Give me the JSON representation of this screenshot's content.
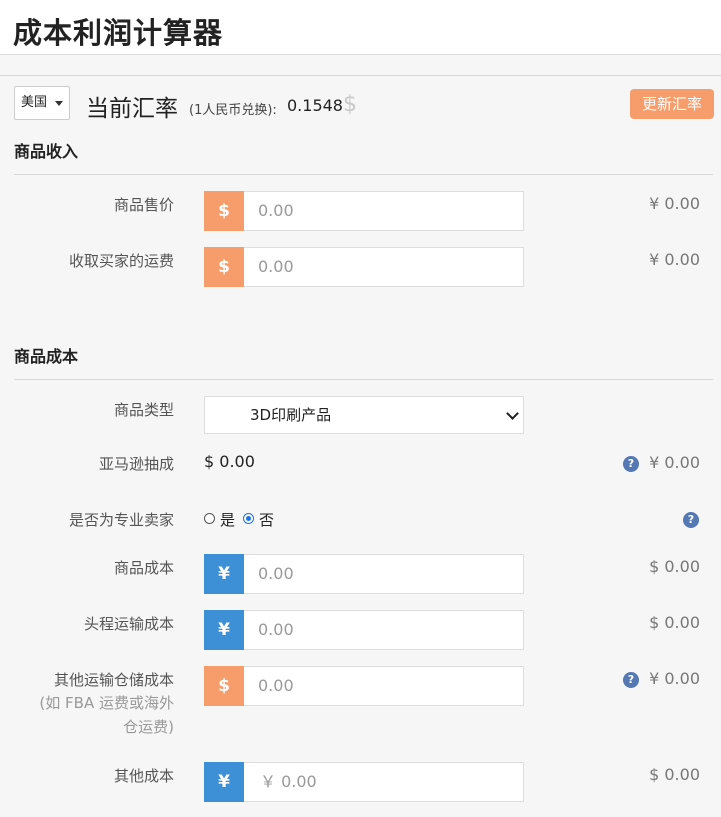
{
  "header": {
    "title": "成本利润计算器"
  },
  "exchange": {
    "country": "美国",
    "title": "当前汇率",
    "note": "(1人民币兑换):",
    "value": "0.1548",
    "currency_symbol": "$",
    "update_label": "更新汇率"
  },
  "income": {
    "title": "商品收入",
    "fields": [
      {
        "label": "商品售价",
        "addon": "$",
        "value": "0.00",
        "result": "¥ 0.00"
      },
      {
        "label": "收取买家的运费",
        "addon": "$",
        "value": "0.00",
        "result": "¥ 0.00"
      }
    ]
  },
  "cost": {
    "title": "商品成本",
    "type": {
      "label": "商品类型",
      "selected": "3D印刷产品"
    },
    "commission": {
      "label": "亚马逊抽成",
      "value": "$ 0.00",
      "result": "¥ 0.00"
    },
    "pro_seller": {
      "label": "是否为专业卖家",
      "options": [
        "是",
        "否"
      ],
      "selected": "否"
    },
    "fields": [
      {
        "label": "商品成本",
        "addon": "¥",
        "value": "0.00",
        "result": "$ 0.00"
      },
      {
        "label": "头程运输成本",
        "addon": "¥",
        "value": "0.00",
        "result": "$ 0.00"
      },
      {
        "label": "其他运输仓储成本",
        "sublabel": [
          "(如 FBA 运费或海外",
          "仓运费)"
        ],
        "addon": "$",
        "value": "0.00",
        "result": "¥ 0.00"
      },
      {
        "label": "其他成本",
        "addon": "¥",
        "value": "￥ 0.00",
        "result": "$ 0.00"
      }
    ]
  },
  "icons": {
    "help": "?"
  },
  "colors": {
    "orange": "#f79d6b",
    "blue": "#3d8fd6",
    "help": "#5378b4"
  }
}
